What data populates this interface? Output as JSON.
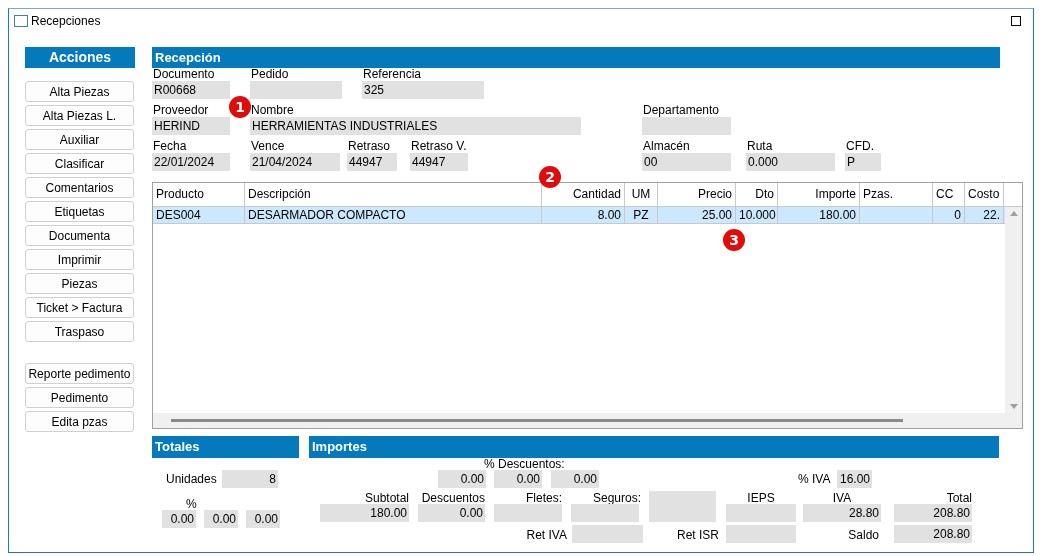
{
  "window": {
    "title": "Recepciones"
  },
  "actions": {
    "title": "Acciones",
    "groups": [
      [
        "Alta Piezas",
        "Alta Piezas L.",
        "Auxiliar",
        "Clasificar",
        "Comentarios",
        "Etiquetas",
        "Documenta",
        "Imprimir",
        "Piezas",
        "Ticket > Factura",
        "Traspaso"
      ],
      [
        "Reporte pedimento",
        "Pedimento",
        "Edita pzas"
      ]
    ]
  },
  "reception": {
    "title": "Recepción",
    "main_fields": [
      [
        {
          "label": "Documento",
          "value": "R00668"
        },
        {
          "label": "Pedido"
        },
        {
          "label": "Referencia",
          "value": "325"
        }
      ],
      [
        {
          "label": "Proveedor",
          "value": "HERIND"
        },
        {
          "label": "Nombre",
          "value": "HERRAMIENTAS INDUSTRIALES"
        }
      ],
      [
        {
          "label": "Fecha",
          "value": "22/01/2024"
        },
        {
          "label": "Vence",
          "value": "21/04/2024"
        },
        {
          "label": "Retraso",
          "value": "44947"
        },
        {
          "label": "Retraso V.",
          "value": "44947"
        }
      ]
    ],
    "side_fields": [
      {
        "label": "Departamento"
      },
      {
        "label": "Almacén",
        "value": "00"
      },
      {
        "label": "Ruta",
        "value": "0.000"
      },
      {
        "label": "CFD.",
        "value": "P"
      }
    ]
  },
  "annotations": [
    "1",
    "2",
    "3"
  ],
  "table": {
    "columns": [
      "Producto",
      "Descripción",
      "Cantidad",
      "UM",
      "Precio",
      "Dto",
      "Importe",
      "Pzas.",
      "CC",
      "Costo"
    ],
    "rows": [
      {
        "selected": true,
        "cells": [
          "DES004",
          "DESARMADOR COMPACTO",
          "8.00",
          "PZ",
          "25.00",
          "10.000",
          "180.00",
          "",
          "0",
          "22."
        ]
      }
    ]
  },
  "totals": {
    "title": "Totales",
    "units": {
      "label": "Unidades",
      "value": "8"
    },
    "percent_label": "%",
    "percents": [
      "0.00",
      "0.00",
      "0.00"
    ]
  },
  "importes": {
    "title": "Importes",
    "discounts_label": "% Descuentos:",
    "discounts": [
      "0.00",
      "0.00",
      "0.00"
    ],
    "iva_rate": {
      "label": "% IVA",
      "value": "16.00"
    },
    "amounts": [
      {
        "label": "Subtotal",
        "value": "180.00"
      },
      {
        "label": "Descuentos",
        "value": "0.00"
      },
      {
        "label": "Fletes:"
      },
      {
        "label": "Seguros:"
      },
      {
        "label": "IEPS"
      },
      {
        "label": "IVA",
        "value": "28.80"
      },
      {
        "label": "Total",
        "value": "208.80"
      }
    ],
    "retentions": [
      {
        "label": "Ret IVA"
      },
      {
        "label": "Ret ISR"
      },
      {
        "label": "Saldo",
        "value": "208.80"
      }
    ]
  }
}
